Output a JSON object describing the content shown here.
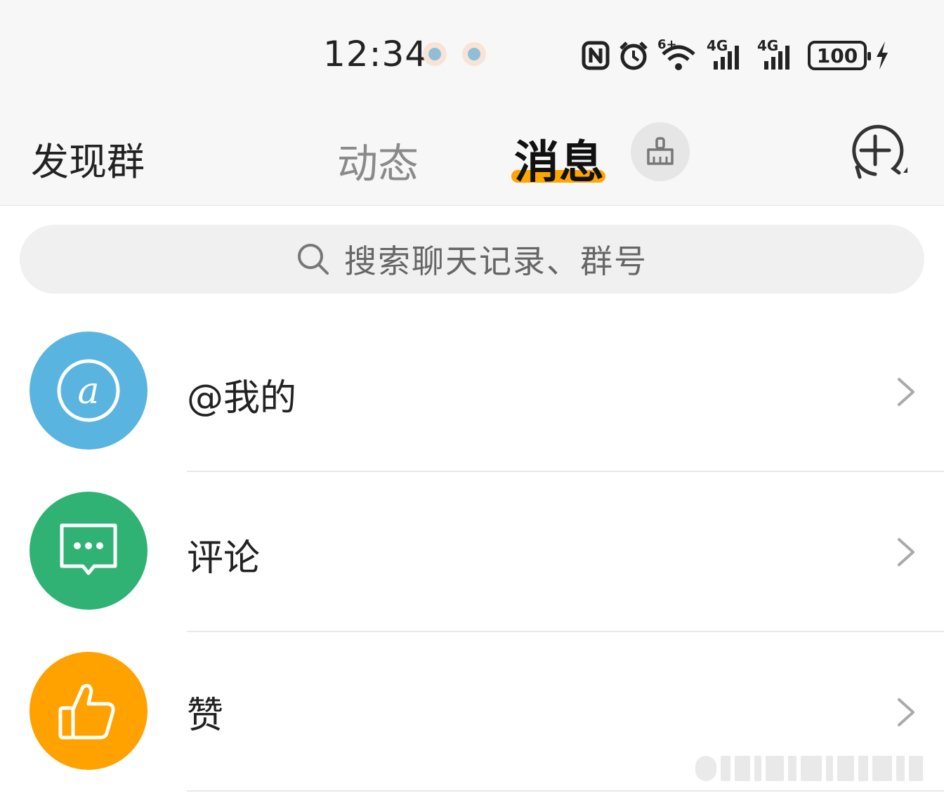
{
  "status": {
    "time": "12:34",
    "signal_label_1": "4G",
    "signal_label_2": "4G",
    "wifi_label": "6+",
    "battery": "100"
  },
  "header": {
    "left_link": "发现群",
    "tabs": [
      {
        "label": "动态",
        "active": false
      },
      {
        "label": "消息",
        "active": true
      }
    ]
  },
  "search": {
    "placeholder": "搜索聊天记录、群号"
  },
  "list": [
    {
      "label": "@我的",
      "icon": "at-icon",
      "color": "#5ab4e0"
    },
    {
      "label": "评论",
      "icon": "comment-icon",
      "color": "#2fb273"
    },
    {
      "label": "赞",
      "icon": "thumbs-up-icon",
      "color": "#ffa200"
    }
  ],
  "colors": {
    "accent": "#ffa500",
    "background": "#f7f7f7"
  }
}
